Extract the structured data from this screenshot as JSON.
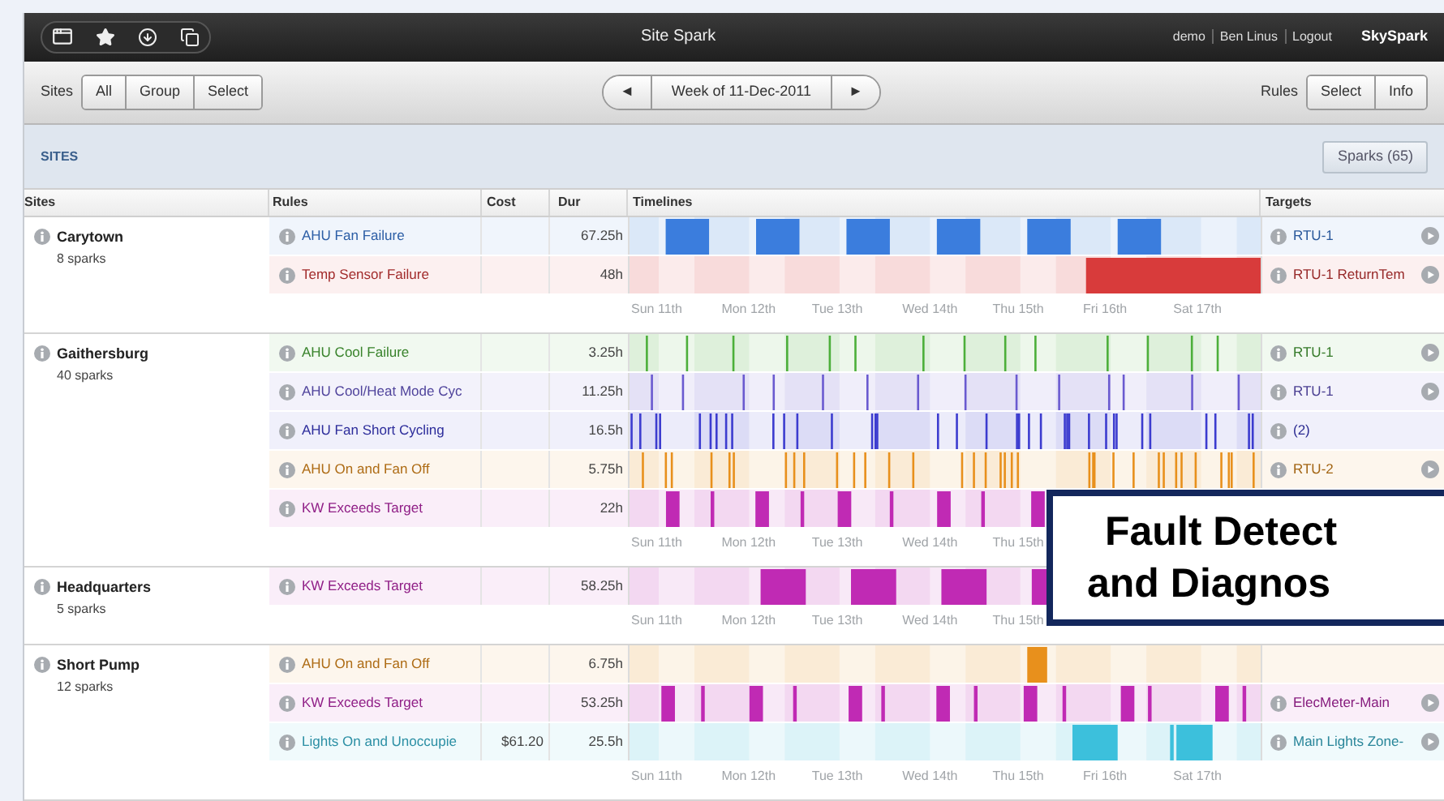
{
  "window": {
    "title": "Site Spark",
    "user_links": [
      "demo",
      "Ben Linus",
      "Logout"
    ],
    "brand": "SkySpark"
  },
  "toolbar": {
    "sites_label": "Sites",
    "sites_buttons": [
      "All",
      "Group",
      "Select"
    ],
    "prev": "◄",
    "week": "Week of 11-Dec-2011",
    "next": "►",
    "rules_label": "Rules",
    "rules_buttons": [
      "Select",
      "Info"
    ]
  },
  "section": {
    "title": "SITES",
    "sparks_button": "Sparks (65)"
  },
  "table": {
    "columns": [
      "Sites",
      "Rules",
      "Cost",
      "Dur",
      "Timelines",
      "Targets"
    ],
    "sites": [
      {
        "name": "Carytown",
        "sparks": "8 sparks",
        "axis": [
          "Sun 11th",
          "Mon 12th",
          "Tue 13th",
          "Wed 14th",
          "Thu 15th",
          "Fri 16th",
          "Sat 17th"
        ],
        "rules": [
          {
            "name": "AHU Fan Failure",
            "dur": "67.25h",
            "color": "#3b7ddd",
            "kind": "daily-blocks",
            "target": "RTU-1",
            "target_action": true
          },
          {
            "name": "Temp Sensor Failure",
            "dur": "48h",
            "color": "#d83b3b",
            "kind": "end-block",
            "target": "RTU-1 ReturnTem",
            "target_action": true
          }
        ]
      },
      {
        "name": "Gaithersburg",
        "sparks": "40 sparks",
        "axis": [
          "Sun 11th",
          "Mon 12th",
          "Tue 13th",
          "Wed 14th",
          "Thu 15th"
        ],
        "rules": [
          {
            "name": "AHU Cool Failure",
            "dur": "3.25h",
            "color": "#4caf3a",
            "kind": "spikes",
            "target": "RTU-1",
            "target_action": true
          },
          {
            "name": "AHU Cool/Heat Mode Cyc",
            "dur": "11.25h",
            "color": "#6a5ad0",
            "kind": "spikes",
            "target": "RTU-1",
            "target_action": true
          },
          {
            "name": "AHU Fan Short Cycling",
            "dur": "16.5h",
            "color": "#3c3ccf",
            "kind": "dense-spikes",
            "target": "(2)",
            "target_action": false
          },
          {
            "name": "AHU On and Fan Off",
            "dur": "5.75h",
            "color": "#e8901c",
            "kind": "dense-spikes",
            "target": "RTU-2",
            "target_action": true
          },
          {
            "name": "KW Exceeds Target",
            "dur": "22h",
            "color": "#c02ab4",
            "kind": "wide-spikes"
          }
        ]
      },
      {
        "name": "Headquarters",
        "sparks": "5 sparks",
        "axis": [
          "Sun 11th",
          "Mon 12th",
          "Tue 13th",
          "Wed 14th",
          "Thu 15th"
        ],
        "rules": [
          {
            "name": "KW Exceeds Target",
            "dur": "58.25h",
            "color": "#c02ab4",
            "kind": "late-blocks"
          }
        ]
      },
      {
        "name": "Short Pump",
        "sparks": "12 sparks",
        "axis": [
          "Sun 11th",
          "Mon 12th",
          "Tue 13th",
          "Wed 14th",
          "Thu 15th",
          "Fri 16th",
          "Sat 17th"
        ],
        "rules": [
          {
            "name": "AHU On and Fan Off",
            "dur": "6.75h",
            "color": "#e8901c",
            "kind": "single-block"
          },
          {
            "name": "KW Exceeds Target",
            "dur": "53.25h",
            "color": "#c02ab4",
            "kind": "wide-spikes",
            "target": "ElecMeter-Main",
            "target_action": true
          },
          {
            "name": "Lights On and Unoccupie",
            "cost": "$61.20",
            "dur": "25.5h",
            "color": "#3cc0dc",
            "kind": "lights",
            "target": "Main Lights Zone-",
            "target_action": true
          }
        ]
      }
    ]
  },
  "callout": {
    "lines": [
      "Fault Detect",
      "and Diagnos"
    ]
  }
}
